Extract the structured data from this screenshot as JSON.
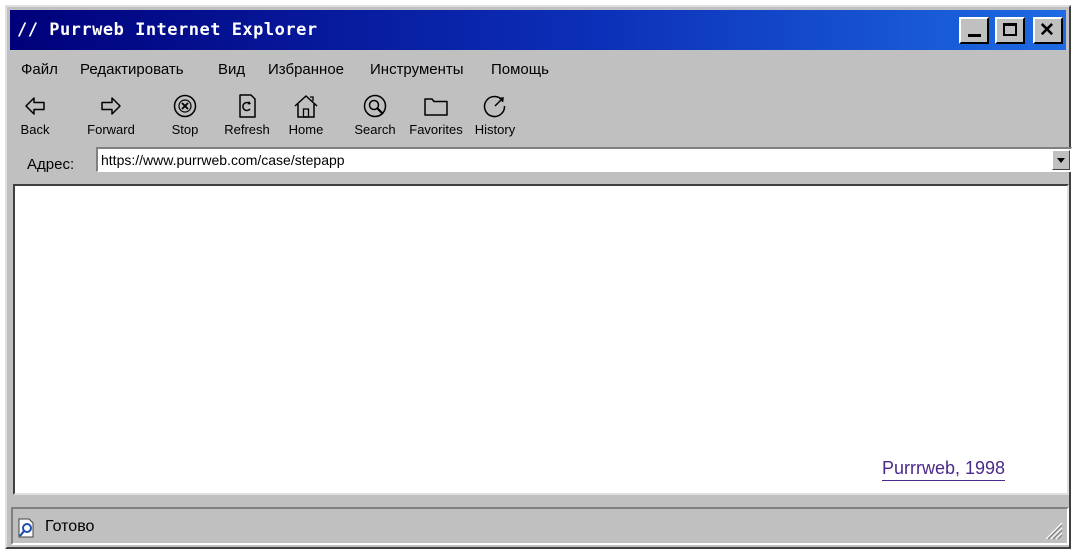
{
  "window": {
    "title": "// Purrweb Internet Explorer",
    "controls": {
      "minimize": "minimize",
      "maximize": "maximize",
      "close": "✕"
    }
  },
  "menu": [
    {
      "label": "Файл"
    },
    {
      "label": "Редактировать"
    },
    {
      "label": "Вид"
    },
    {
      "label": "Избранное"
    },
    {
      "label": "Инструменты"
    },
    {
      "label": "Помощь"
    }
  ],
  "toolbar": [
    {
      "label": "Back",
      "icon": "back-arrow-icon"
    },
    {
      "label": "Forward",
      "icon": "forward-arrow-icon"
    },
    {
      "label": "Stop",
      "icon": "stop-icon"
    },
    {
      "label": "Refresh",
      "icon": "refresh-icon"
    },
    {
      "label": "Home",
      "icon": "home-icon"
    },
    {
      "label": "Search",
      "icon": "search-icon"
    },
    {
      "label": "Favorites",
      "icon": "folder-icon"
    },
    {
      "label": "History",
      "icon": "history-icon"
    }
  ],
  "address": {
    "label": "Адрес:",
    "value": "https://www.purrweb.com/case/stepapp"
  },
  "page": {
    "credit": "Purrrweb, 1998"
  },
  "status": {
    "text": "Готово"
  },
  "colors": {
    "titlebar_start": "#00007a",
    "titlebar_end": "#1d6ae4",
    "chrome": "#c0c0c0",
    "link": "#4a2a8a"
  }
}
